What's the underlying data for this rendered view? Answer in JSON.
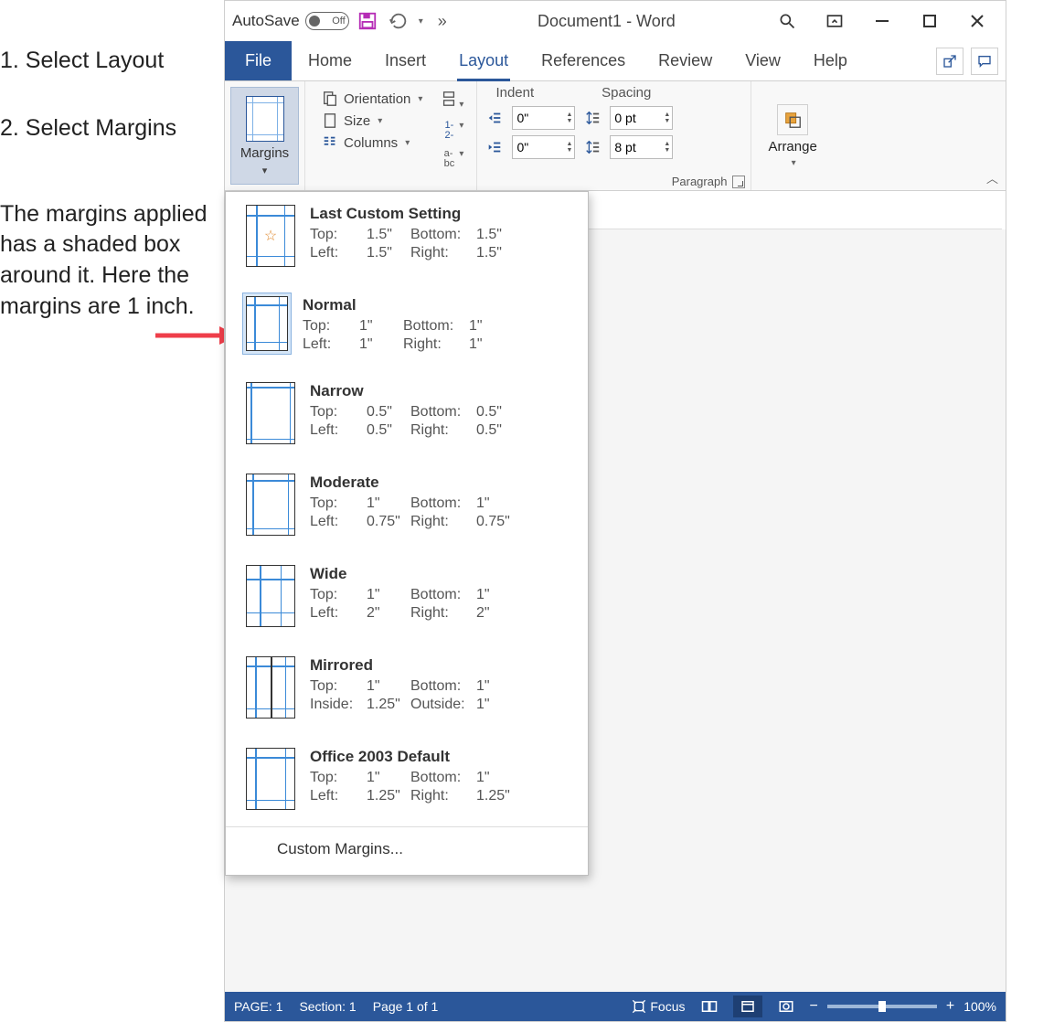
{
  "annotations": {
    "step1": "1. Select Layout",
    "step2": "2. Select Margins",
    "note": "The margins applied has a shaded box around it. Here the margins are 1 inch."
  },
  "titlebar": {
    "autosave_label": "AutoSave",
    "autosave_state": "Off",
    "doc_title": "Document1  -  Word",
    "more": "»"
  },
  "tabs": {
    "file": "File",
    "home": "Home",
    "insert": "Insert",
    "layout": "Layout",
    "references": "References",
    "review": "Review",
    "view": "View",
    "help": "Help"
  },
  "ribbon": {
    "margins_label": "Margins",
    "orientation": "Orientation",
    "size": "Size",
    "columns": "Columns",
    "breaks": "Breaks",
    "line_numbers": "Line Numbers",
    "hyphenation": "Hyphenation",
    "indent_label": "Indent",
    "spacing_label": "Spacing",
    "indent_left": "0\"",
    "indent_right": "0\"",
    "spacing_before": "0 pt",
    "spacing_after": "8 pt",
    "paragraph_name": "Paragraph",
    "arrange_label": "Arrange"
  },
  "margins_menu": {
    "items": [
      {
        "name": "Last Custom Setting",
        "l1": "Top:",
        "v1": "1.5\"",
        "l2": "Bottom:",
        "v2": "1.5\"",
        "l3": "Left:",
        "v3": "1.5\"",
        "l4": "Right:",
        "v4": "1.5\"",
        "star": true,
        "m": 10,
        "selected": false
      },
      {
        "name": "Normal",
        "l1": "Top:",
        "v1": "1\"",
        "l2": "Bottom:",
        "v2": "1\"",
        "l3": "Left:",
        "v3": "1\"",
        "l4": "Right:",
        "v4": "1\"",
        "m": 8,
        "selected": true
      },
      {
        "name": "Narrow",
        "l1": "Top:",
        "v1": "0.5\"",
        "l2": "Bottom:",
        "v2": "0.5\"",
        "l3": "Left:",
        "v3": "0.5\"",
        "l4": "Right:",
        "v4": "0.5\"",
        "m": 4,
        "selected": false
      },
      {
        "name": "Moderate",
        "l1": "Top:",
        "v1": "1\"",
        "l2": "Bottom:",
        "v2": "1\"",
        "l3": "Left:",
        "v3": "0.75\"",
        "l4": "Right:",
        "v4": "0.75\"",
        "m": 6,
        "selected": false
      },
      {
        "name": "Wide",
        "l1": "Top:",
        "v1": "1\"",
        "l2": "Bottom:",
        "v2": "1\"",
        "l3": "Left:",
        "v3": "2\"",
        "l4": "Right:",
        "v4": "2\"",
        "m": 14,
        "selected": false
      },
      {
        "name": "Mirrored",
        "l1": "Top:",
        "v1": "1\"",
        "l2": "Bottom:",
        "v2": "1\"",
        "l3": "Inside:",
        "v3": "1.25\"",
        "l4": "Outside:",
        "v4": "1\"",
        "m": 9,
        "selected": false,
        "mirror": true
      },
      {
        "name": "Office 2003 Default",
        "l1": "Top:",
        "v1": "1\"",
        "l2": "Bottom:",
        "v2": "1\"",
        "l3": "Left:",
        "v3": "1.25\"",
        "l4": "Right:",
        "v4": "1.25\"",
        "m": 9,
        "selected": false
      }
    ],
    "custom": "Custom Margins..."
  },
  "statusbar": {
    "page": "PAGE: 1",
    "section": "Section: 1",
    "pageof": "Page 1 of 1",
    "focus": "Focus",
    "zoom": "100%"
  }
}
